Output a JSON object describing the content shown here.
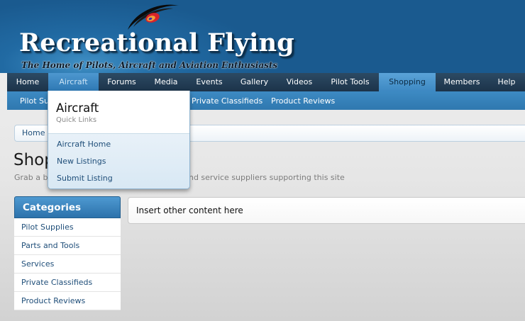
{
  "site": {
    "title": "Recreational Flying",
    "tagline": "The Home of Pilots, Aircraft and Aviation Enthusiasts"
  },
  "nav": {
    "tabs": [
      {
        "label": "Home"
      },
      {
        "label": "Aircraft",
        "state": "hover"
      },
      {
        "label": "Forums"
      },
      {
        "label": "Media"
      },
      {
        "label": "Events"
      },
      {
        "label": "Gallery"
      },
      {
        "label": "Videos"
      },
      {
        "label": "Pilot Tools"
      },
      {
        "label": "Shopping",
        "state": "selected"
      },
      {
        "label": "Members"
      },
      {
        "label": "Help"
      }
    ]
  },
  "subnav": {
    "links": [
      {
        "label": "Pilot Sup"
      },
      {
        "label": "Private Classifieds"
      },
      {
        "label": "Product Reviews"
      }
    ]
  },
  "breadcrumb": {
    "items": [
      {
        "label": "Home"
      }
    ]
  },
  "page": {
    "title": "Shop",
    "description_start": "Grab a ba",
    "description_end": "and service suppliers supporting this site"
  },
  "sidebar": {
    "heading": "Categories",
    "items": [
      {
        "label": "Pilot Supplies"
      },
      {
        "label": "Parts and Tools"
      },
      {
        "label": "Services"
      },
      {
        "label": "Private Classifieds"
      },
      {
        "label": "Product Reviews"
      }
    ]
  },
  "content": {
    "text": "Insert other content here"
  },
  "dropdown": {
    "title": "Aircraft",
    "subtitle": "Quick Links",
    "items": [
      {
        "label": "Aircraft Home"
      },
      {
        "label": "New Listings"
      },
      {
        "label": "Submit Listing"
      }
    ]
  },
  "icons": {
    "logo": "logo-swoosh-icon"
  },
  "colors": {
    "header_blue": "#216aa3",
    "nav_dark": "#1c3349",
    "subnav_blue": "#3d8ac3",
    "link_blue": "#1f4e79",
    "tab_selected": "#5aa3d8"
  }
}
